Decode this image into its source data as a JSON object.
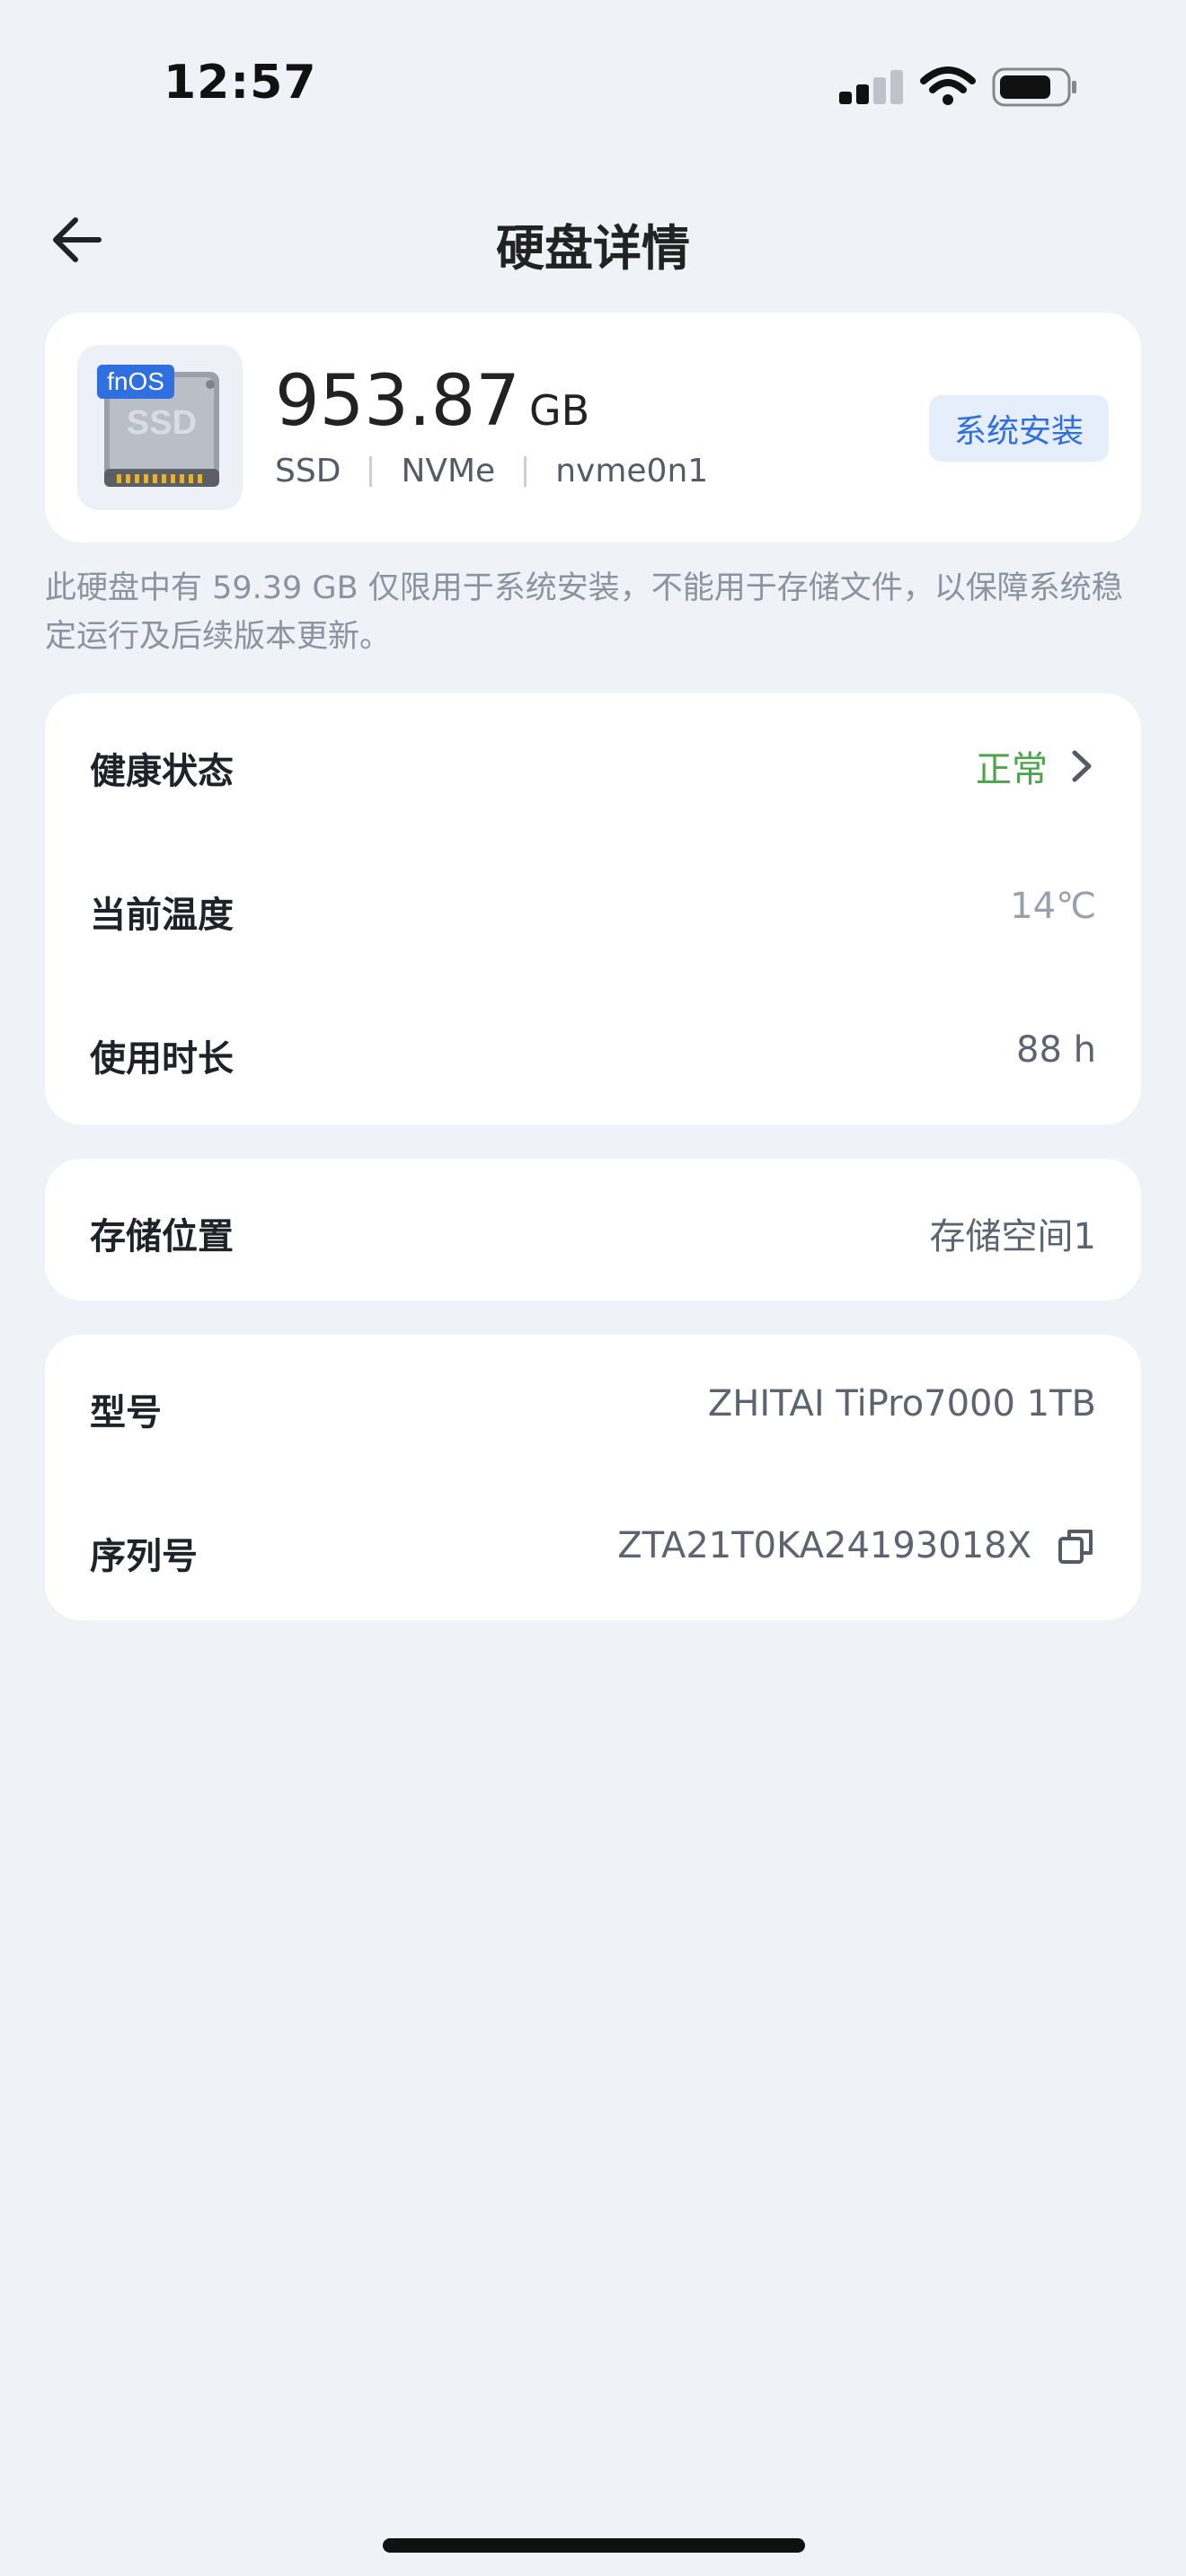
{
  "status_bar": {
    "time": "12:57"
  },
  "header": {
    "title": "硬盘详情"
  },
  "disk": {
    "icon_badge": "fnOS",
    "icon_text": "SSD",
    "capacity_value": "953.87",
    "capacity_unit": "GB",
    "tags": [
      "SSD",
      "NVMe",
      "nvme0n1"
    ],
    "badge": "系统安装"
  },
  "note": "此硬盘中有 59.39 GB 仅限用于系统安装，不能用于存储文件，以保障系统稳定运行及后续版本更新。",
  "health": {
    "health_label": "健康状态",
    "health_value": "正常",
    "temp_label": "当前温度",
    "temp_value": "14℃",
    "usage_label": "使用时长",
    "usage_value": "88 h"
  },
  "storage": {
    "label": "存储位置",
    "value": "存储空间1"
  },
  "info": {
    "model_label": "型号",
    "model_value": "ZHITAI TiPro7000 1TB",
    "serial_label": "序列号",
    "serial_value": "ZTA21T0KA24193018X"
  },
  "colors": {
    "accent": "#2f6fe0",
    "healthy": "#4aa44a",
    "background": "#eff2f7"
  }
}
